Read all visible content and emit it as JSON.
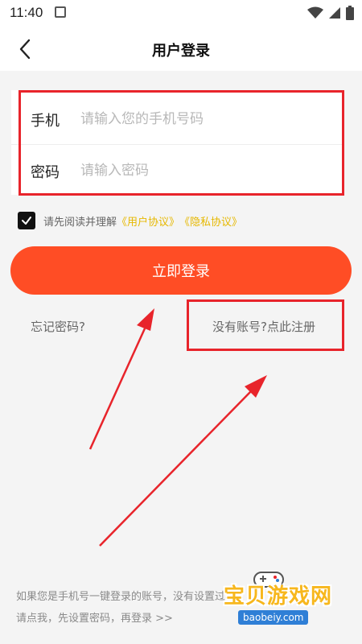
{
  "status_bar": {
    "time": "11:40"
  },
  "header": {
    "title": "用户登录"
  },
  "form": {
    "phone": {
      "label": "手机",
      "placeholder": "请输入您的手机号码"
    },
    "password": {
      "label": "密码",
      "placeholder": "请输入密码"
    }
  },
  "agreement": {
    "checked": true,
    "text": "请先阅读并理解",
    "user_agreement": "《用户协议》",
    "privacy_policy": "《隐私协议》"
  },
  "login_button": "立即登录",
  "links": {
    "forgot": "忘记密码?",
    "register": "没有账号?点此注册"
  },
  "footer": {
    "line1": "如果您是手机号一键登录的账号，没有设置过",
    "line2": "请点我，先设置密码，再登录 >>"
  },
  "watermark": {
    "title": "宝贝游戏网",
    "url": "baobeiy.com"
  },
  "colors": {
    "accent": "#ff4d25",
    "highlight": "#e8242b",
    "link": "#e6b800",
    "annotation_arrow": "#e8242b"
  },
  "icons": [
    "back-arrow-icon",
    "app-notification-icon",
    "wifi-icon",
    "cellular-signal-icon",
    "battery-icon",
    "checkmark-icon",
    "gamepad-icon"
  ]
}
